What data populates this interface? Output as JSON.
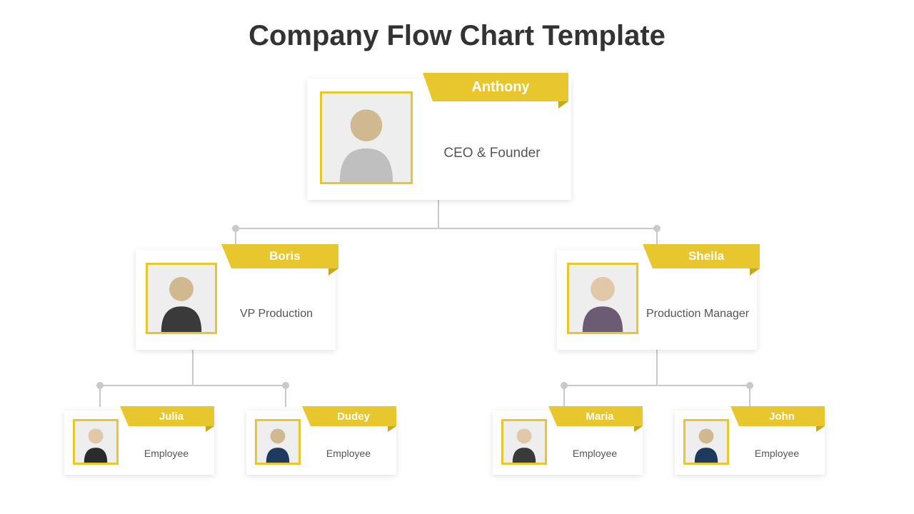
{
  "title": "Company Flow Chart Template",
  "nodes": {
    "ceo": {
      "name": "Anthony",
      "role": "CEO & Founder"
    },
    "vp": {
      "name": "Boris",
      "role": "VP Production"
    },
    "pm": {
      "name": "Sheila",
      "role": "Production Manager"
    },
    "emp1": {
      "name": "Julia",
      "role": "Employee"
    },
    "emp2": {
      "name": "Dudey",
      "role": "Employee"
    },
    "emp3": {
      "name": "Maria",
      "role": "Employee"
    },
    "emp4": {
      "name": "John",
      "role": "Employee"
    }
  },
  "colors": {
    "accent": "#e8c72e"
  }
}
